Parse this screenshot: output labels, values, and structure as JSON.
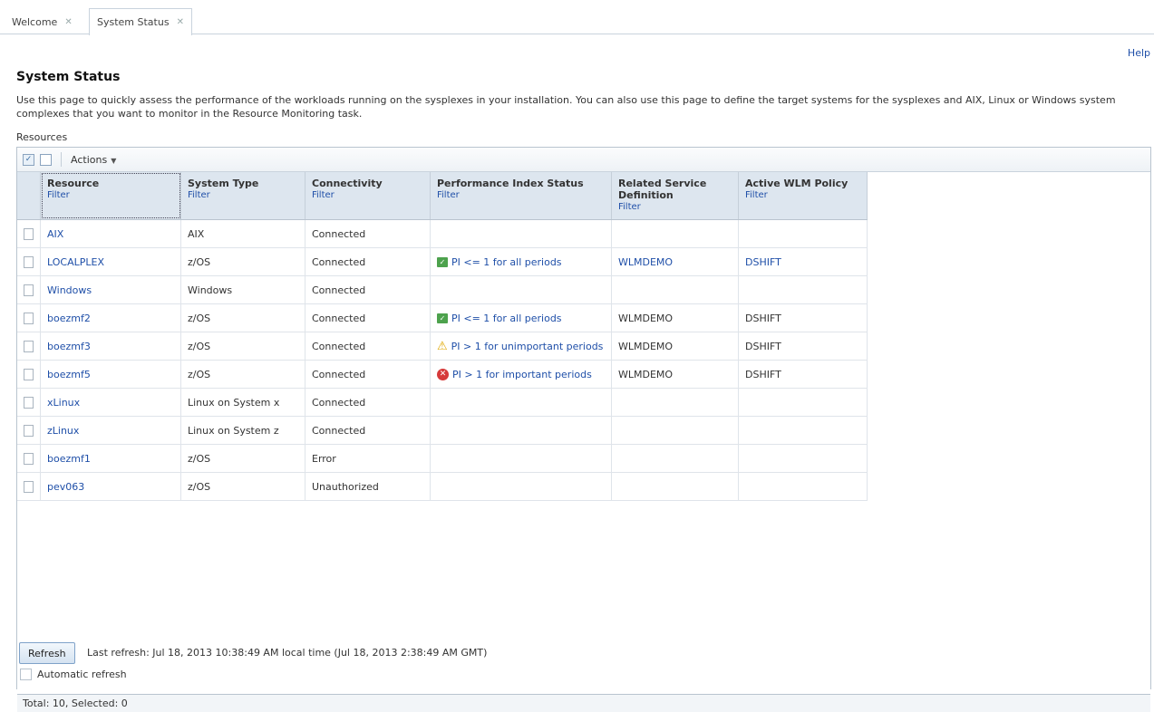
{
  "tabs": [
    {
      "label": "Welcome",
      "close": "✕"
    },
    {
      "label": "System Status",
      "close": "✕"
    }
  ],
  "help_link": "Help",
  "page_title": "System Status",
  "description": "Use this page to quickly assess the performance of the workloads running on the sysplexes in your installation. You can also use this page to define the target systems for the sysplexes and AIX, Linux or Windows system complexes that you want to monitor in the Resource Monitoring task.",
  "resources_label": "Resources",
  "toolbar": {
    "actions_label": "Actions"
  },
  "table": {
    "filter_label": "Filter",
    "columns": [
      "Resource",
      "System Type",
      "Connectivity",
      "Performance Index Status",
      "Related Service Definition",
      "Active WLM Policy"
    ],
    "rows": [
      {
        "resource": "AIX",
        "system_type": "AIX",
        "connectivity": "Connected",
        "pi_status": "",
        "pi_icon": "",
        "service_definition": "",
        "wlm_policy": "",
        "links": false
      },
      {
        "resource": "LOCALPLEX",
        "system_type": "z/OS",
        "connectivity": "Connected",
        "pi_status": "PI <= 1 for all periods",
        "pi_icon": "ok-icon",
        "service_definition": "WLMDEMO",
        "wlm_policy": "DSHIFT",
        "links": true
      },
      {
        "resource": "Windows",
        "system_type": "Windows",
        "connectivity": "Connected",
        "pi_status": "",
        "pi_icon": "",
        "service_definition": "",
        "wlm_policy": "",
        "links": false
      },
      {
        "resource": "boezmf2",
        "system_type": "z/OS",
        "connectivity": "Connected",
        "pi_status": "PI <= 1 for all periods",
        "pi_icon": "ok-icon",
        "service_definition": "WLMDEMO",
        "wlm_policy": "DSHIFT",
        "links": false
      },
      {
        "resource": "boezmf3",
        "system_type": "z/OS",
        "connectivity": "Connected",
        "pi_status": "PI > 1 for unimportant periods",
        "pi_icon": "warning-icon",
        "service_definition": "WLMDEMO",
        "wlm_policy": "DSHIFT",
        "links": false
      },
      {
        "resource": "boezmf5",
        "system_type": "z/OS",
        "connectivity": "Connected",
        "pi_status": "PI > 1 for important periods",
        "pi_icon": "error-icon",
        "service_definition": "WLMDEMO",
        "wlm_policy": "DSHIFT",
        "links": false
      },
      {
        "resource": "xLinux",
        "system_type": "Linux on System x",
        "connectivity": "Connected",
        "pi_status": "",
        "pi_icon": "",
        "service_definition": "",
        "wlm_policy": "",
        "links": false
      },
      {
        "resource": "zLinux",
        "system_type": "Linux on System z",
        "connectivity": "Connected",
        "pi_status": "",
        "pi_icon": "",
        "service_definition": "",
        "wlm_policy": "",
        "links": false
      },
      {
        "resource": "boezmf1",
        "system_type": "z/OS",
        "connectivity": "Error",
        "pi_status": "",
        "pi_icon": "",
        "service_definition": "",
        "wlm_policy": "",
        "links": false
      },
      {
        "resource": "pev063",
        "system_type": "z/OS",
        "connectivity": "Unauthorized",
        "pi_status": "",
        "pi_icon": "",
        "service_definition": "",
        "wlm_policy": "",
        "links": false
      }
    ]
  },
  "footer_status": "Total: 10, Selected: 0",
  "refresh": {
    "button_label": "Refresh",
    "last_refresh": "Last refresh: Jul 18, 2013 10:38:49 AM local time (Jul 18, 2013 2:38:49 AM GMT)",
    "auto_label": "Automatic refresh"
  },
  "colors": {
    "link": "#1f4fa8",
    "header_bg": "#dde6ef",
    "ok": "#4da24d",
    "warning": "#e0a800",
    "error": "#d63a3a"
  }
}
